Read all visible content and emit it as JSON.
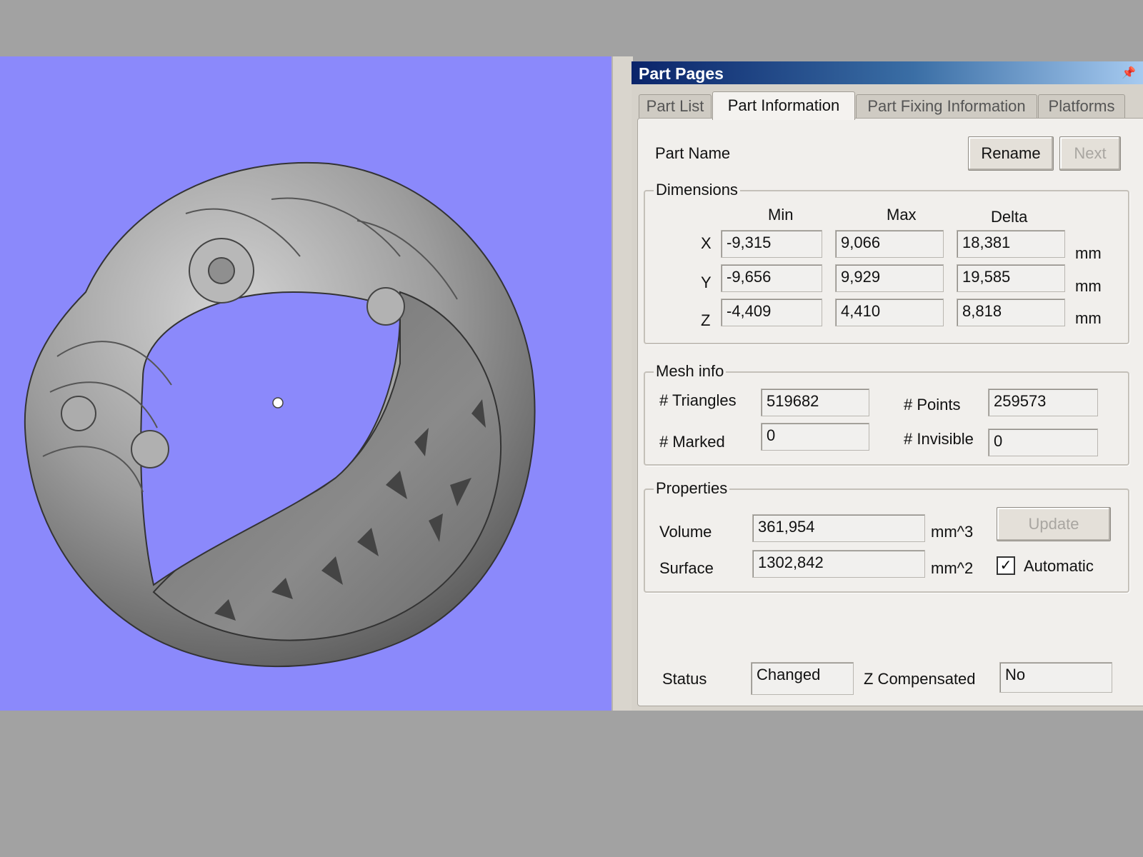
{
  "panel": {
    "title": "Part Pages",
    "pin_icon": "pin-icon",
    "tabs": [
      {
        "label": "Part List",
        "active": false
      },
      {
        "label": "Part Information",
        "active": true
      },
      {
        "label": "Part Fixing Information",
        "active": false
      },
      {
        "label": "Platforms",
        "active": false
      }
    ]
  },
  "part_name": {
    "label": "Part Name",
    "rename_label": "Rename",
    "next_label": "Next"
  },
  "dimensions": {
    "title": "Dimensions",
    "col_min": "Min",
    "col_max": "Max",
    "col_delta": "Delta",
    "rows": [
      {
        "axis": "X",
        "min": "-9,315",
        "max": "9,066",
        "delta": "18,381",
        "unit": "mm"
      },
      {
        "axis": "Y",
        "min": "-9,656",
        "max": "9,929",
        "delta": "19,585",
        "unit": "mm"
      },
      {
        "axis": "Z",
        "min": "-4,409",
        "max": "4,410",
        "delta": "8,818",
        "unit": "mm"
      }
    ]
  },
  "mesh_info": {
    "title": "Mesh info",
    "triangles_label": "# Triangles",
    "triangles_value": "519682",
    "points_label": "# Points",
    "points_value": "259573",
    "marked_label": "# Marked",
    "marked_value": "0",
    "invisible_label": "# Invisible",
    "invisible_value": "0"
  },
  "properties": {
    "title": "Properties",
    "volume_label": "Volume",
    "volume_value": "361,954",
    "volume_unit": "mm^3",
    "surface_label": "Surface",
    "surface_value": "1302,842",
    "surface_unit": "mm^2",
    "update_label": "Update",
    "automatic_label": "Automatic",
    "automatic_checked": true,
    "check_glyph": "✓"
  },
  "status": {
    "label": "Status",
    "value": "Changed",
    "z_label": "Z Compensated",
    "z_value": "No"
  },
  "viewport": {
    "background": "#8b89fb",
    "model": "ring-model-render",
    "pivot_icon": "rotation-center-icon"
  }
}
